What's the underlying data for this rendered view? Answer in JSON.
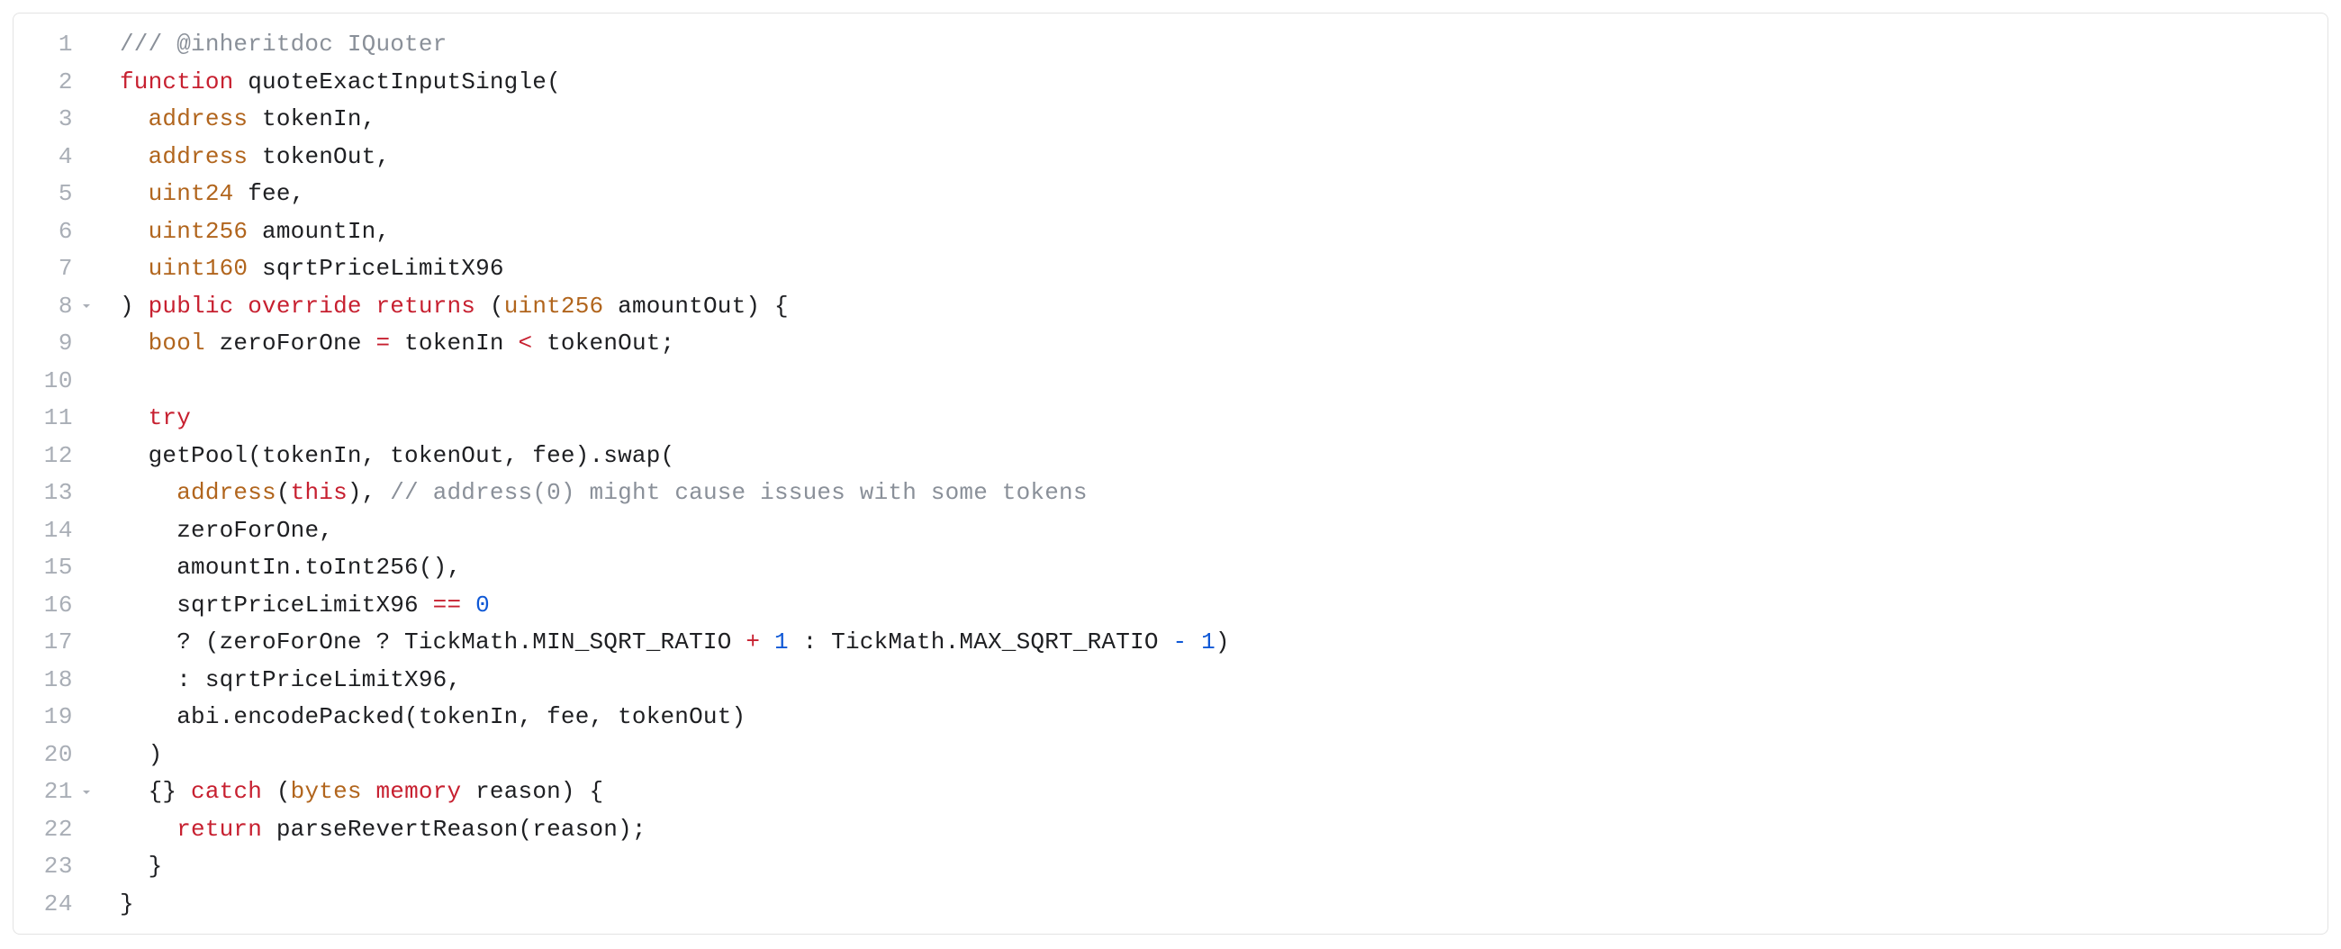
{
  "editor": {
    "line_count": 24,
    "fold_lines": [
      8,
      21
    ],
    "lines": [
      {
        "n": 1,
        "indent": 0,
        "tokens": [
          {
            "cls": "tok-comment",
            "text": "/// @inheritdoc IQuoter"
          }
        ]
      },
      {
        "n": 2,
        "indent": 0,
        "tokens": [
          {
            "cls": "tok-keyword",
            "text": "function"
          },
          {
            "cls": "tok-plain",
            "text": " quoteExactInputSingle("
          }
        ]
      },
      {
        "n": 3,
        "indent": 1,
        "tokens": [
          {
            "cls": "tok-type",
            "text": "address"
          },
          {
            "cls": "tok-plain",
            "text": " tokenIn,"
          }
        ]
      },
      {
        "n": 4,
        "indent": 1,
        "tokens": [
          {
            "cls": "tok-type",
            "text": "address"
          },
          {
            "cls": "tok-plain",
            "text": " tokenOut,"
          }
        ]
      },
      {
        "n": 5,
        "indent": 1,
        "tokens": [
          {
            "cls": "tok-type",
            "text": "uint24"
          },
          {
            "cls": "tok-plain",
            "text": " fee,"
          }
        ]
      },
      {
        "n": 6,
        "indent": 1,
        "tokens": [
          {
            "cls": "tok-type",
            "text": "uint256"
          },
          {
            "cls": "tok-plain",
            "text": " amountIn,"
          }
        ]
      },
      {
        "n": 7,
        "indent": 1,
        "tokens": [
          {
            "cls": "tok-type",
            "text": "uint160"
          },
          {
            "cls": "tok-plain",
            "text": " sqrtPriceLimitX96"
          }
        ]
      },
      {
        "n": 8,
        "indent": 0,
        "tokens": [
          {
            "cls": "tok-plain",
            "text": ") "
          },
          {
            "cls": "tok-keyword",
            "text": "public"
          },
          {
            "cls": "tok-plain",
            "text": " "
          },
          {
            "cls": "tok-keyword",
            "text": "override"
          },
          {
            "cls": "tok-plain",
            "text": " "
          },
          {
            "cls": "tok-keyword",
            "text": "returns"
          },
          {
            "cls": "tok-plain",
            "text": " ("
          },
          {
            "cls": "tok-type",
            "text": "uint256"
          },
          {
            "cls": "tok-plain",
            "text": " amountOut) {"
          }
        ]
      },
      {
        "n": 9,
        "indent": 1,
        "tokens": [
          {
            "cls": "tok-type",
            "text": "bool"
          },
          {
            "cls": "tok-plain",
            "text": " zeroForOne "
          },
          {
            "cls": "tok-op-red",
            "text": "="
          },
          {
            "cls": "tok-plain",
            "text": " tokenIn "
          },
          {
            "cls": "tok-op-red",
            "text": "<"
          },
          {
            "cls": "tok-plain",
            "text": " tokenOut;"
          }
        ]
      },
      {
        "n": 10,
        "indent": 0,
        "tokens": []
      },
      {
        "n": 11,
        "indent": 1,
        "tokens": [
          {
            "cls": "tok-keyword",
            "text": "try"
          }
        ]
      },
      {
        "n": 12,
        "indent": 1,
        "tokens": [
          {
            "cls": "tok-plain",
            "text": "getPool(tokenIn, tokenOut, fee).swap("
          }
        ]
      },
      {
        "n": 13,
        "indent": 2,
        "tokens": [
          {
            "cls": "tok-type",
            "text": "address"
          },
          {
            "cls": "tok-plain",
            "text": "("
          },
          {
            "cls": "tok-keyword",
            "text": "this"
          },
          {
            "cls": "tok-plain",
            "text": "), "
          },
          {
            "cls": "tok-comment",
            "text": "// address(0) might cause issues with some tokens"
          }
        ]
      },
      {
        "n": 14,
        "indent": 2,
        "tokens": [
          {
            "cls": "tok-plain",
            "text": "zeroForOne,"
          }
        ]
      },
      {
        "n": 15,
        "indent": 2,
        "tokens": [
          {
            "cls": "tok-plain",
            "text": "amountIn.toInt256(),"
          }
        ]
      },
      {
        "n": 16,
        "indent": 2,
        "tokens": [
          {
            "cls": "tok-plain",
            "text": "sqrtPriceLimitX96 "
          },
          {
            "cls": "tok-op-red",
            "text": "=="
          },
          {
            "cls": "tok-plain",
            "text": " "
          },
          {
            "cls": "tok-number",
            "text": "0"
          }
        ]
      },
      {
        "n": 17,
        "indent": 2,
        "tokens": [
          {
            "cls": "tok-plain",
            "text": "? (zeroForOne ? TickMath.MIN_SQRT_RATIO "
          },
          {
            "cls": "tok-op-red",
            "text": "+"
          },
          {
            "cls": "tok-plain",
            "text": " "
          },
          {
            "cls": "tok-number",
            "text": "1"
          },
          {
            "cls": "tok-plain",
            "text": " : TickMath.MAX_SQRT_RATIO "
          },
          {
            "cls": "tok-op-blue",
            "text": "-"
          },
          {
            "cls": "tok-plain",
            "text": " "
          },
          {
            "cls": "tok-number",
            "text": "1"
          },
          {
            "cls": "tok-plain",
            "text": ")"
          }
        ]
      },
      {
        "n": 18,
        "indent": 2,
        "tokens": [
          {
            "cls": "tok-plain",
            "text": ": sqrtPriceLimitX96,"
          }
        ]
      },
      {
        "n": 19,
        "indent": 2,
        "tokens": [
          {
            "cls": "tok-plain",
            "text": "abi.encodePacked(tokenIn, fee, tokenOut)"
          }
        ]
      },
      {
        "n": 20,
        "indent": 1,
        "tokens": [
          {
            "cls": "tok-plain",
            "text": ")"
          }
        ]
      },
      {
        "n": 21,
        "indent": 1,
        "tokens": [
          {
            "cls": "tok-plain",
            "text": "{} "
          },
          {
            "cls": "tok-keyword",
            "text": "catch"
          },
          {
            "cls": "tok-plain",
            "text": " ("
          },
          {
            "cls": "tok-type",
            "text": "bytes"
          },
          {
            "cls": "tok-plain",
            "text": " "
          },
          {
            "cls": "tok-keyword",
            "text": "memory"
          },
          {
            "cls": "tok-plain",
            "text": " reason) {"
          }
        ]
      },
      {
        "n": 22,
        "indent": 2,
        "tokens": [
          {
            "cls": "tok-keyword",
            "text": "return"
          },
          {
            "cls": "tok-plain",
            "text": " parseRevertReason(reason);"
          }
        ]
      },
      {
        "n": 23,
        "indent": 1,
        "tokens": [
          {
            "cls": "tok-plain",
            "text": "}"
          }
        ]
      },
      {
        "n": 24,
        "indent": 0,
        "tokens": [
          {
            "cls": "tok-plain",
            "text": "}"
          }
        ]
      }
    ]
  }
}
